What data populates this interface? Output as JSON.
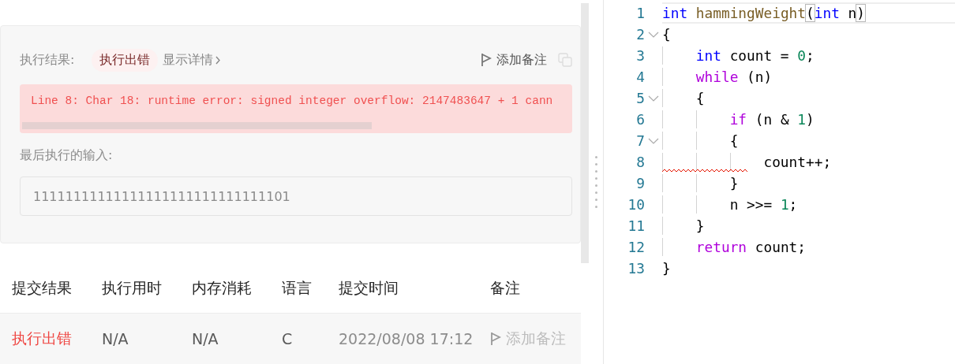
{
  "result_panel": {
    "label": "执行结果:",
    "status": "执行出错",
    "details_link": "显示详情",
    "add_note": "添加备注",
    "error_message": "Line 8: Char 18: runtime error: signed integer overflow: 2147483647 + 1 cann",
    "last_input_label": "最后执行的输入:",
    "last_input": "11111111111111111111111111111101"
  },
  "submissions": {
    "columns": [
      "提交结果",
      "执行用时",
      "内存消耗",
      "语言",
      "提交时间",
      "备注"
    ],
    "rows": [
      {
        "result": "执行出错",
        "failed": true,
        "runtime": "N/A",
        "memory": "N/A",
        "language": "C",
        "time": "2022/08/08 17:12",
        "note": "添加备注"
      }
    ]
  },
  "editor": {
    "lines": [
      {
        "number": "1",
        "foldable": false,
        "current": true,
        "error": false,
        "tokens": [
          {
            "t": "int",
            "kind": "type"
          },
          {
            "t": " hammingWeight",
            "kind": "func"
          },
          {
            "t": "(",
            "kind": "bracket"
          },
          {
            "t": "int",
            "kind": "type"
          },
          {
            "t": " n",
            "kind": "plain"
          },
          {
            "t": ")",
            "kind": "bracket"
          }
        ]
      },
      {
        "number": "2",
        "foldable": true,
        "current": false,
        "error": false,
        "tokens": [
          {
            "t": "{",
            "kind": "plain"
          }
        ]
      },
      {
        "number": "3",
        "foldable": false,
        "current": false,
        "error": false,
        "tokens": [
          {
            "t": "    int",
            "kind": "type"
          },
          {
            "t": " count = ",
            "kind": "plain"
          },
          {
            "t": "0",
            "kind": "number"
          },
          {
            "t": ";",
            "kind": "plain"
          }
        ]
      },
      {
        "number": "4",
        "foldable": false,
        "current": false,
        "error": false,
        "tokens": [
          {
            "t": "    while",
            "kind": "control"
          },
          {
            "t": " (n)",
            "kind": "plain"
          }
        ]
      },
      {
        "number": "5",
        "foldable": true,
        "current": false,
        "error": false,
        "tokens": [
          {
            "t": "    {",
            "kind": "plain"
          }
        ]
      },
      {
        "number": "6",
        "foldable": false,
        "current": false,
        "error": false,
        "tokens": [
          {
            "t": "        if",
            "kind": "control"
          },
          {
            "t": " (n & ",
            "kind": "plain"
          },
          {
            "t": "1",
            "kind": "number"
          },
          {
            "t": ")",
            "kind": "plain"
          }
        ]
      },
      {
        "number": "7",
        "foldable": true,
        "current": false,
        "error": false,
        "tokens": [
          {
            "t": "        {",
            "kind": "plain"
          }
        ]
      },
      {
        "number": "8",
        "foldable": false,
        "current": false,
        "error": true,
        "tokens": [
          {
            "t": "            count++;",
            "kind": "plain"
          }
        ]
      },
      {
        "number": "9",
        "foldable": false,
        "current": false,
        "error": false,
        "tokens": [
          {
            "t": "        }",
            "kind": "plain"
          }
        ]
      },
      {
        "number": "10",
        "foldable": false,
        "current": false,
        "error": false,
        "tokens": [
          {
            "t": "        n >>= ",
            "kind": "plain"
          },
          {
            "t": "1",
            "kind": "number"
          },
          {
            "t": ";",
            "kind": "plain"
          }
        ]
      },
      {
        "number": "11",
        "foldable": false,
        "current": false,
        "error": false,
        "tokens": [
          {
            "t": "    }",
            "kind": "plain"
          }
        ]
      },
      {
        "number": "12",
        "foldable": false,
        "current": false,
        "error": false,
        "tokens": [
          {
            "t": "    return",
            "kind": "control"
          },
          {
            "t": " count;",
            "kind": "plain"
          }
        ]
      },
      {
        "number": "13",
        "foldable": false,
        "current": false,
        "error": false,
        "tokens": [
          {
            "t": "}",
            "kind": "plain"
          }
        ]
      }
    ]
  }
}
